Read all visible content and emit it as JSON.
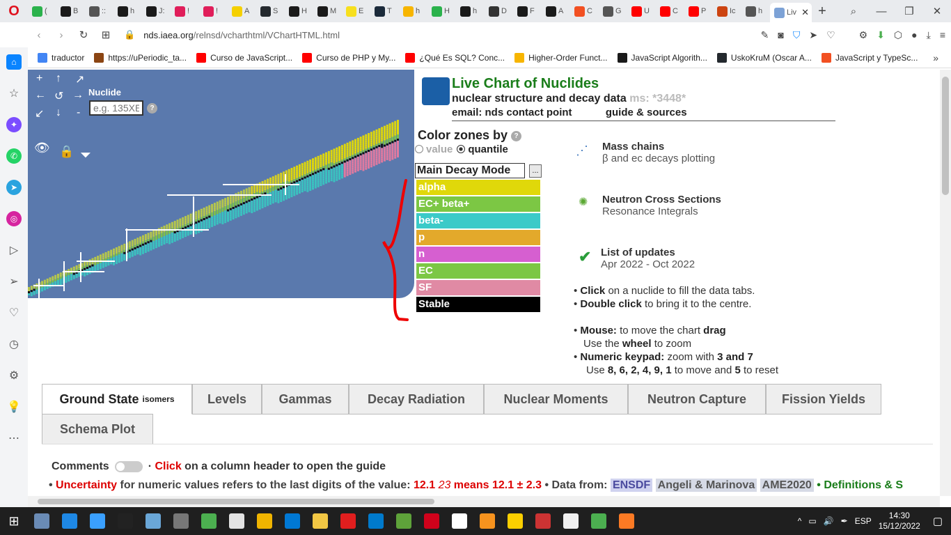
{
  "browser": {
    "tabs": [
      {
        "label": "(",
        "color": "#2bb24c"
      },
      {
        "label": "B",
        "color": "#1a1a1a"
      },
      {
        "label": "::",
        "color": "#555"
      },
      {
        "label": "h",
        "color": "#1a1a1a"
      },
      {
        "label": "J:",
        "color": "#1a1a1a"
      },
      {
        "label": "!",
        "color": "#e01e5a"
      },
      {
        "label": "!",
        "color": "#e01e5a"
      },
      {
        "label": "A",
        "color": "#f5d000"
      },
      {
        "label": "S",
        "color": "#24292e"
      },
      {
        "label": "H",
        "color": "#1a1a1a"
      },
      {
        "label": "M",
        "color": "#1a1a1a"
      },
      {
        "label": "E",
        "color": "#f7df1e"
      },
      {
        "label": "T",
        "color": "#1b2a3a"
      },
      {
        "label": "h",
        "color": "#f7b500"
      },
      {
        "label": "H",
        "color": "#2bb24c"
      },
      {
        "label": "h",
        "color": "#1a1a1a"
      },
      {
        "label": "D",
        "color": "#333"
      },
      {
        "label": "F",
        "color": "#1a1a1a"
      },
      {
        "label": "A",
        "color": "#1a1a1a"
      },
      {
        "label": "C",
        "color": "#f25022"
      },
      {
        "label": "G",
        "color": "#555"
      },
      {
        "label": "U",
        "color": "#ff0000"
      },
      {
        "label": "C",
        "color": "#ff0000"
      },
      {
        "label": "P",
        "color": "#ff0000"
      },
      {
        "label": "Ic",
        "color": "#c41"
      },
      {
        "label": "h",
        "color": "#555"
      }
    ],
    "active_tab": "Liv",
    "url_host": "nds.iaea.org",
    "url_path": "/relnsd/vcharthtml/VChartHTML.html",
    "bookmarks": [
      {
        "label": "traductor",
        "color": "#4285f4"
      },
      {
        "label": "https://uPeriodic_ta...",
        "color": "#8b4513"
      },
      {
        "label": "Curso de JavaScript...",
        "color": "#ff0000"
      },
      {
        "label": "Curso de PHP y My...",
        "color": "#ff0000"
      },
      {
        "label": "¿Qué Es SQL? Conc...",
        "color": "#ff0000"
      },
      {
        "label": "Higher-Order Funct...",
        "color": "#f7b500"
      },
      {
        "label": "JavaScript Algorith...",
        "color": "#1a1a1a"
      },
      {
        "label": "UskoKruM (Oscar A...",
        "color": "#24292e"
      },
      {
        "label": "JavaScript y TypeSc...",
        "color": "#f25022"
      }
    ]
  },
  "chart": {
    "nuclide_label": "Nuclide",
    "nuclide_placeholder": "e.g. 135XE",
    "help": "?"
  },
  "header": {
    "title": "Live Chart of Nuclides",
    "subtitle": "nuclear structure and decay data",
    "ms": "ms: *3448*",
    "email": "email: nds contact point",
    "guide": "guide & sources"
  },
  "color_zones": {
    "title": "Color zones by",
    "option_value": "value",
    "option_quantile": "quantile",
    "selected": "quantile",
    "mode": "Main Decay Mode",
    "more": "...",
    "legend": [
      {
        "label": "alpha",
        "color": "#e0d80a"
      },
      {
        "label": "EC+ beta+",
        "color": "#7cc744"
      },
      {
        "label": "beta-",
        "color": "#3bcac8"
      },
      {
        "label": "p",
        "color": "#e3a92b"
      },
      {
        "label": "n",
        "color": "#d65fd0"
      },
      {
        "label": "EC",
        "color": "#7cc744"
      },
      {
        "label": "SF",
        "color": "#e08aa4"
      },
      {
        "label": "Stable",
        "color": "#000000"
      }
    ]
  },
  "features": {
    "mass_title": "Mass chains",
    "mass_sub": "β and ec decays plotting",
    "neutron_title": "Neutron Cross Sections",
    "neutron_sub": "Resonance Integrals",
    "updates_title": "List of updates",
    "updates_sub": "Apr 2022 - Oct 2022"
  },
  "tips": {
    "click_b": "Click",
    "click_t": " on a nuclide to fill the data tabs.",
    "dbl_b": "Double click",
    "dbl_t": " to bring it to the centre.",
    "mouse_b": "Mouse:",
    "mouse_t": " to move the chart ",
    "drag": "drag",
    "wheel_pre": "Use the ",
    "wheel_b": "wheel",
    "wheel_t": " to zoom",
    "keypad_b": "Numeric keypad:",
    "keypad_t": " zoom with ",
    "keys37": "3 and 7",
    "use_pre": "Use ",
    "keys_move": "8, 6, 2, 4, 9, 1",
    "use_mid": " to move and ",
    "key5": "5",
    "use_end": " to reset"
  },
  "tabs": {
    "ground": "Ground State",
    "isomers": "isomers",
    "levels": "Levels",
    "gammas": "Gammas",
    "decay": "Decay Radiation",
    "moments": "Nuclear Moments",
    "capture": "Neutron Capture",
    "fission": "Fission Yields",
    "schema": "Schema Plot"
  },
  "comments": {
    "label": "Comments",
    "click": "Click",
    "rest": " on a column header to open the guide"
  },
  "uncertainty": {
    "word": "Uncertainty",
    "rest": " for numeric values refers to the last digits of the value: ",
    "ex1": "12.1 ",
    "ex2": "23",
    "ex3": " means 12.1 ± 2.3",
    "from": " • Data from: ",
    "src1": "ENSDF",
    "src2": "Angeli & Marinova",
    "src3": "AME2020",
    "defs": " • Definitions & S"
  },
  "system": {
    "lang": "ESP",
    "time": "14:30",
    "date": "15/12/2022"
  }
}
